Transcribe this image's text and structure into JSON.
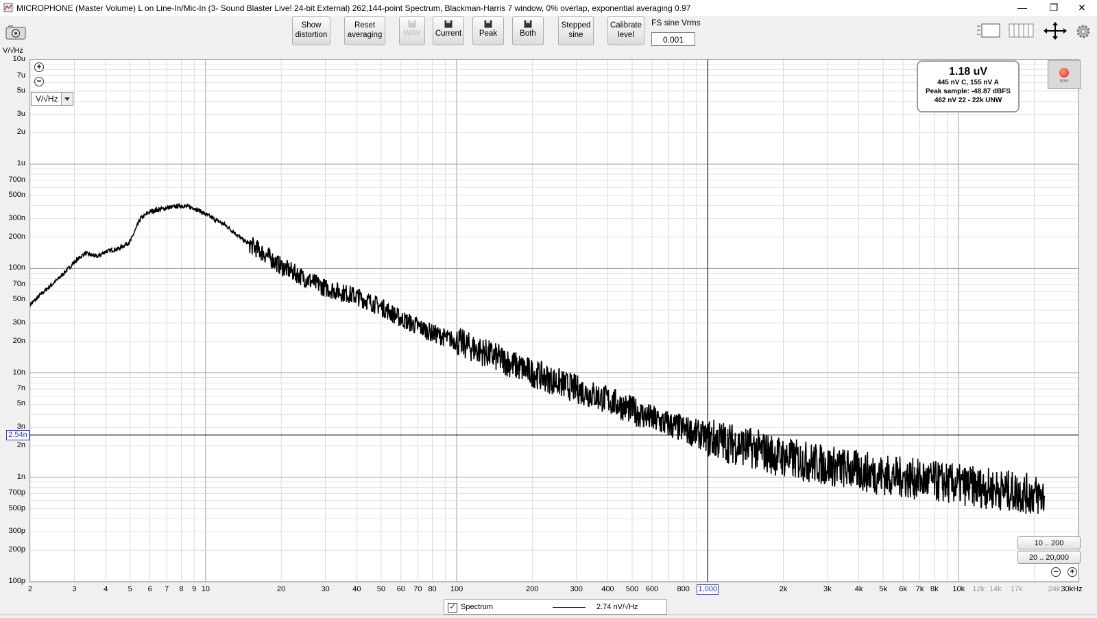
{
  "window": {
    "title": "MICROPHONE (Master Volume) L on Line-In/Mic-In (3- Sound Blaster Live! 24-bit External) 262,144-point Spectrum, Blackman-Harris 7 window, 0% overlap, exponential averaging 0.97",
    "minimize_glyph": "—",
    "restore_glyph": "❐",
    "close_glyph": "✕"
  },
  "toolbar": {
    "show_distortion": "Show distortion",
    "reset_averaging": "Reset averaging",
    "wav": "WAV",
    "current": "Current",
    "peak": "Peak",
    "both": "Both",
    "stepped_sine": "Stepped sine",
    "calibrate_level": "Calibrate level",
    "fs_label": "FS sine Vrms",
    "fs_value": "0.001"
  },
  "axes": {
    "y_unit_label": "V/√Hz",
    "unit_select": "V/√Hz",
    "cursor_x": "1,000",
    "cursor_y": "2.54n",
    "y_ticks": [
      "10u",
      "7u",
      "5u",
      "3u",
      "2u",
      "1u",
      "700n",
      "500n",
      "300n",
      "200n",
      "100n",
      "70n",
      "50n",
      "30n",
      "20n",
      "10n",
      "7n",
      "5n",
      "3n",
      "2n",
      "1n",
      "700p",
      "500p",
      "300p",
      "200p",
      "100p"
    ],
    "x_ticks_major": [
      "2",
      "3",
      "4",
      "5",
      "6",
      "7",
      "8",
      "9",
      "10",
      "20",
      "30",
      "40",
      "50",
      "60",
      "70",
      "80",
      "100",
      "200",
      "300",
      "400",
      "500",
      "600",
      "800",
      "2k",
      "3k",
      "4k",
      "5k",
      "6k",
      "7k",
      "8k",
      "10k",
      "30kHz"
    ],
    "x_ticks_minor": [
      "12k",
      "14k",
      "17k",
      "24k"
    ]
  },
  "readout": {
    "main": "1.18 uV",
    "line1": "445 nV C, 155 nV A",
    "line2": "Peak sample: -48.87 dBFS",
    "line3": "462 nV 22 - 22k UNW"
  },
  "record": {
    "percent": "50%"
  },
  "ranges": {
    "r1": "10 .. 200",
    "r2": "20 .. 20,000"
  },
  "legend": {
    "checked": "✓",
    "name": "Spectrum",
    "reading": "2.74 nV/√Hz"
  },
  "colors": {
    "trace": "#000000",
    "cursor": "#2a38d8",
    "grid": "#c8c8c8",
    "record": "#e3231c"
  },
  "chart_data": {
    "type": "line",
    "title": "",
    "xlabel": "",
    "ylabel": "V/√Hz",
    "x_scale": "log",
    "y_scale": "log",
    "xlim": [
      2,
      30000
    ],
    "ylim": [
      1e-10,
      1e-05
    ],
    "grid": true,
    "series": [
      {
        "name": "Spectrum",
        "x": [
          2,
          2.3,
          2.6,
          3,
          3.3,
          3.7,
          4,
          4.5,
          5,
          5.5,
          6,
          7,
          8,
          9,
          10,
          12,
          14,
          17,
          20,
          25,
          30,
          40,
          50,
          60,
          80,
          100,
          150,
          200,
          300,
          400,
          500,
          600,
          800,
          1000,
          1500,
          2000,
          3000,
          5000,
          7000,
          10000,
          15000,
          20000,
          22000
        ],
        "y": [
          4.5e-08,
          6.2e-08,
          8e-08,
          1.15e-07,
          1.4e-07,
          1.3e-07,
          1.45e-07,
          1.55e-07,
          1.8e-07,
          3e-07,
          3.5e-07,
          3.8e-07,
          4e-07,
          3.8e-07,
          3.3e-07,
          2.6e-07,
          1.9e-07,
          1.4e-07,
          1.05e-07,
          8e-08,
          6.5e-08,
          5.4e-08,
          4.3e-08,
          3.3e-08,
          2.4e-08,
          2e-08,
          1.35e-08,
          1e-08,
          7e-09,
          5.5e-09,
          4.4e-09,
          3.6e-09,
          2.9e-09,
          2.4e-09,
          1.9e-09,
          1.55e-09,
          1.3e-09,
          1.05e-09,
          9.5e-10,
          8.5e-10,
          7.5e-10,
          6.8e-10,
          6.5e-10
        ]
      }
    ],
    "cursor": {
      "x": 1000,
      "y": 2.54e-09
    }
  }
}
